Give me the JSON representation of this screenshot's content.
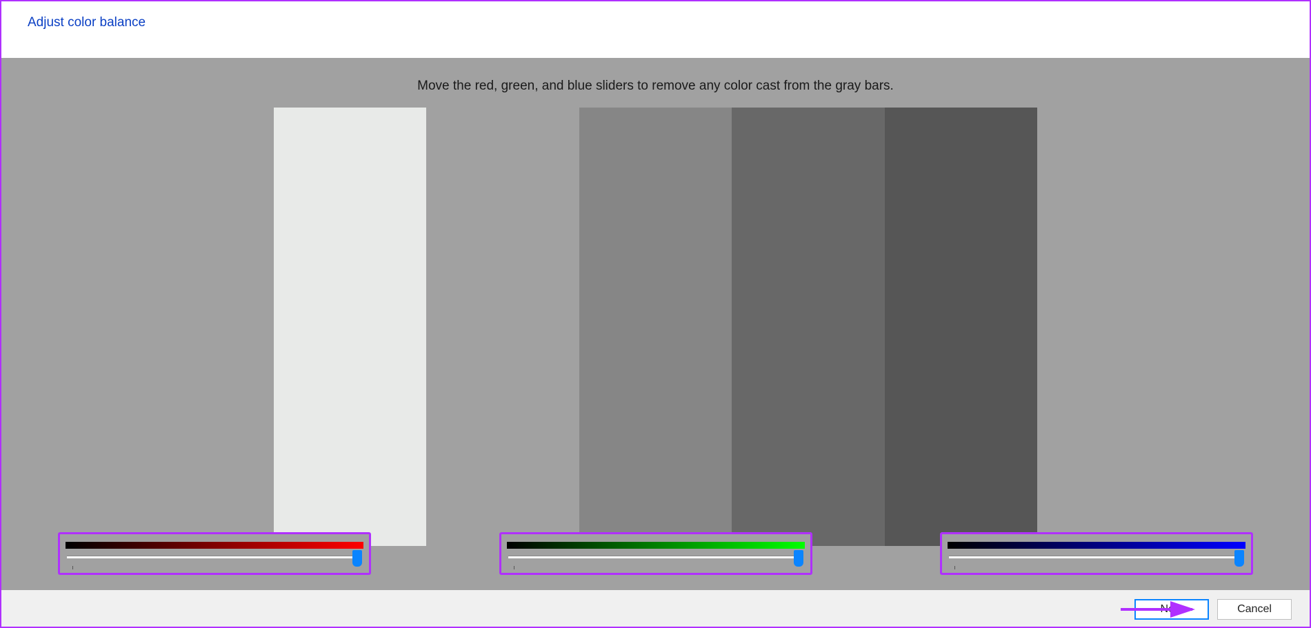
{
  "header": {
    "title": "Adjust color balance"
  },
  "instruction": "Move the red, green, and blue sliders to remove any color cast from the gray bars.",
  "gray_bars": [
    {
      "color": "#e8eae8"
    },
    {
      "color": "#a1a1a1"
    },
    {
      "color": "#868686"
    },
    {
      "color": "#686868"
    },
    {
      "color": "#565656"
    }
  ],
  "sliders": {
    "red": {
      "gradient_from": "#000000",
      "gradient_to": "#ff0000",
      "value_percent": 100
    },
    "green": {
      "gradient_from": "#000000",
      "gradient_to": "#00ff00",
      "value_percent": 100
    },
    "blue": {
      "gradient_from": "#000000",
      "gradient_to": "#0000ff",
      "value_percent": 100
    }
  },
  "footer": {
    "next_label": "Next",
    "cancel_label": "Cancel"
  },
  "annotation": {
    "highlight_color": "#b030ff",
    "arrow_color": "#b030ff"
  }
}
